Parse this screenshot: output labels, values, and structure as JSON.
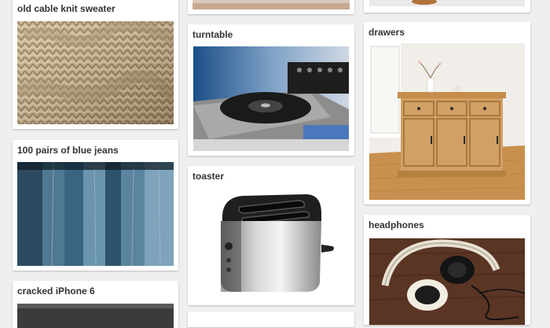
{
  "columns": [
    {
      "cards": [
        {
          "title": "old cable knit sweater",
          "image": "knit-sweater-photo"
        },
        {
          "title": "100 pairs of blue jeans",
          "image": "blue-jeans-photo"
        },
        {
          "title": "cracked iPhone 6",
          "image": "iphone-photo"
        }
      ]
    },
    {
      "cards": [
        {
          "title": "",
          "image": "partial-photo"
        },
        {
          "title": "turntable",
          "image": "turntable-photo"
        },
        {
          "title": "toaster",
          "image": "toaster-photo"
        }
      ]
    },
    {
      "cards": [
        {
          "title": "",
          "image": "partial-photo"
        },
        {
          "title": "drawers",
          "image": "drawers-photo"
        },
        {
          "title": "headphones",
          "image": "headphones-photo"
        }
      ]
    }
  ]
}
